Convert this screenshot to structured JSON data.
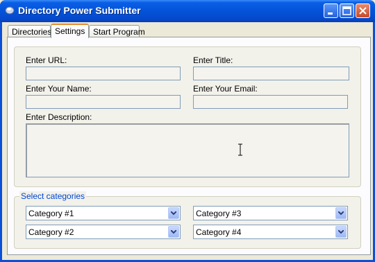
{
  "window": {
    "title": "Directory Power Submitter"
  },
  "tabs": [
    {
      "label": "Directories",
      "active": false
    },
    {
      "label": "Settings",
      "active": true
    },
    {
      "label": "Start Program",
      "active": false
    }
  ],
  "form": {
    "url_label": "Enter URL:",
    "title_label": "Enter Title:",
    "name_label": "Enter Your Name:",
    "email_label": "Enter Your Email:",
    "description_label": "Enter Description:",
    "url_value": "",
    "title_value": "",
    "name_value": "",
    "email_value": "",
    "description_value": ""
  },
  "categories": {
    "group_label": "Select categories",
    "selects": [
      {
        "value": "Category #1"
      },
      {
        "value": "Category #3"
      },
      {
        "value": "Category #2"
      },
      {
        "value": "Category #4"
      }
    ]
  },
  "colors": {
    "titlebar": "#0453d8",
    "group_label": "#0046d5",
    "active_tab_accent": "#e68b2c"
  },
  "icons": {
    "app": "app-icon",
    "minimize": "minimize-icon",
    "maximize": "maximize-icon",
    "close": "close-icon",
    "dropdown": "chevron-down-icon",
    "cursor": "text-cursor-icon"
  }
}
